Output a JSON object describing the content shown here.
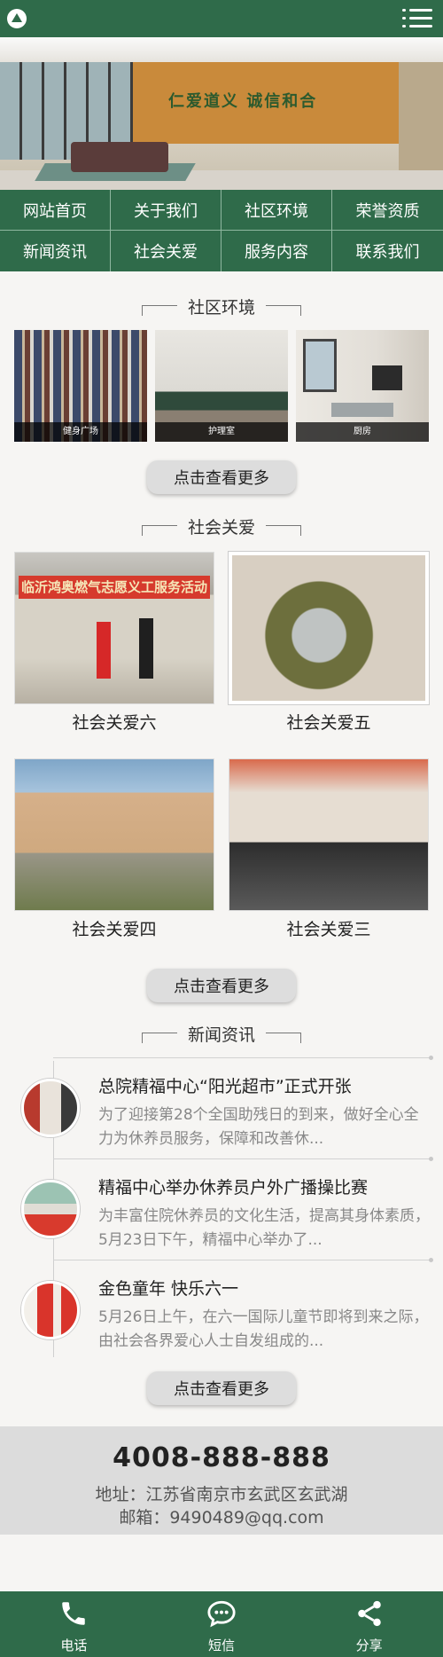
{
  "header": {
    "logo_icon": "mountain-logo-icon",
    "menu_icon": "hamburger-menu-icon"
  },
  "banner": {
    "wall_text": "仁爱道义 诚信和合",
    "dots": 3,
    "active_dot": 0
  },
  "nav": {
    "items": [
      "网站首页",
      "关于我们",
      "社区环境",
      "荣誉资质",
      "新闻资讯",
      "社会关爱",
      "服务内容",
      "联系我们"
    ]
  },
  "environment": {
    "title": "社区环境",
    "items": [
      {
        "caption": "健身广场"
      },
      {
        "caption": "护理室"
      },
      {
        "caption": "厨房"
      }
    ],
    "more_label": "点击查看更多"
  },
  "care": {
    "title": "社会关爱",
    "banner_text": "临沂鸿奥燃气志愿义工服务活动",
    "items": [
      {
        "caption": "社会关爱六"
      },
      {
        "caption": "社会关爱五"
      },
      {
        "caption": "社会关爱四"
      },
      {
        "caption": "社会关爱三"
      }
    ],
    "more_label": "点击查看更多"
  },
  "news": {
    "title": "新闻资讯",
    "items": [
      {
        "title": "总院精福中心“阳光超市”正式开张",
        "desc": "为了迎接第28个全国助残日的到来，做好全心全力为休养员服务，保障和改善休..."
      },
      {
        "title": "精福中心举办休养员户外广播操比赛",
        "desc": "为丰富住院休养员的文化生活，提高其身体素质，5月23日下午，精福中心举办了..."
      },
      {
        "title": "金色童年 快乐六一",
        "desc": "5月26日上午，在六一国际儿童节即将到来之际，由社会各界爱心人士自发组成的..."
      }
    ],
    "more_label": "点击查看更多"
  },
  "contact": {
    "phone": "4008-888-888",
    "address": "地址：江苏省南京市玄武区玄武湖",
    "email": "邮箱：9490489@qq.com"
  },
  "bottom_bar": {
    "items": [
      {
        "label": "电话",
        "icon": "phone-icon"
      },
      {
        "label": "短信",
        "icon": "chat-icon"
      },
      {
        "label": "分享",
        "icon": "share-icon"
      }
    ]
  },
  "colors": {
    "brand": "#2f6b4a",
    "background": "#f6f5f3",
    "button": "#dddddd"
  }
}
